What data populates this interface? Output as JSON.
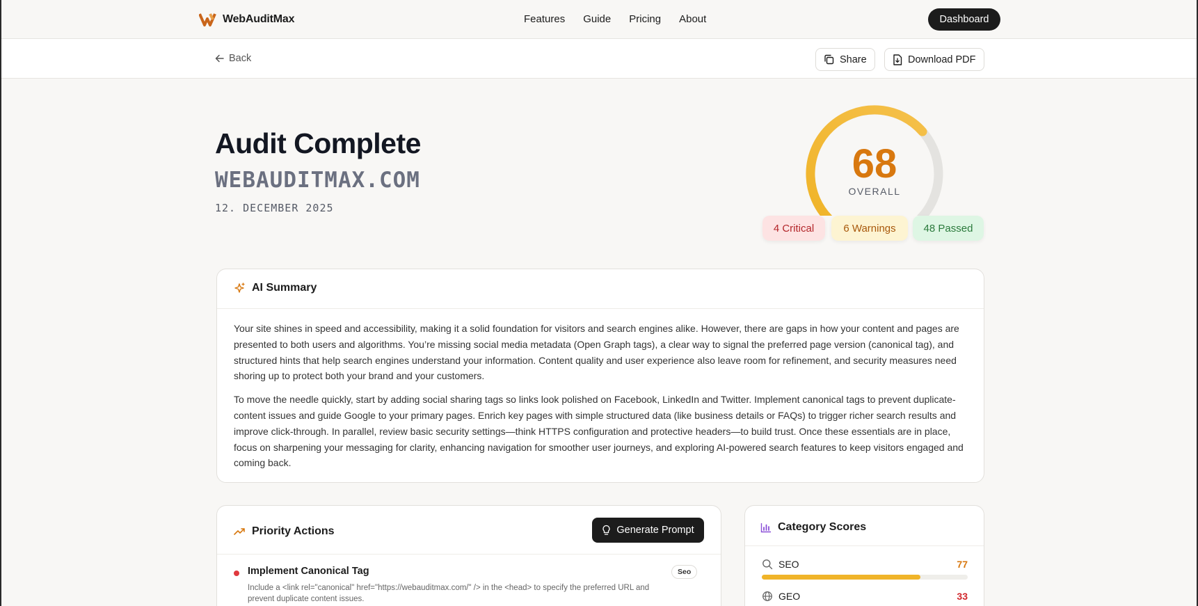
{
  "nav": {
    "brand": "WebAuditMax",
    "links": [
      "Features",
      "Guide",
      "Pricing",
      "About"
    ],
    "dashboard_label": "Dashboard"
  },
  "subbar": {
    "back_label": "Back",
    "share_label": "Share",
    "download_label": "Download PDF"
  },
  "hero": {
    "title": "Audit Complete",
    "domain": "WEBAUDITMAX.COM",
    "date": "12. DECEMBER 2025"
  },
  "score": {
    "value": "68",
    "fraction": 0.68,
    "label": "OVERALL",
    "color": "#d8780f",
    "critical": "4 Critical",
    "warnings": "6 Warnings",
    "passed": "48 Passed"
  },
  "summary": {
    "title": "AI Summary",
    "paragraphs": [
      "Your site shines in speed and accessibility, making it a solid foundation for visitors and search engines alike. However, there are gaps in how your content and pages are presented to both users and algorithms. You’re missing social media metadata (Open Graph tags), a clear way to signal the preferred page version (canonical tag), and structured hints that help search engines understand your information. Content quality and user experience also leave room for refinement, and security measures need shoring up to protect both your brand and your customers.",
      "To move the needle quickly, start by adding social sharing tags so links look polished on Facebook, LinkedIn and Twitter. Implement canonical tags to prevent duplicate-content issues and guide Google to your primary pages. Enrich key pages with simple structured data (like business details or FAQs) to trigger richer search results and improve click-through. In parallel, review basic security settings—think HTTPS configuration and protective headers—to build trust. Once these essentials are in place, focus on sharpening your messaging for clarity, enhancing navigation for smoother user journeys, and exploring AI-powered search features to keep visitors engaged and coming back."
    ]
  },
  "priority": {
    "title": "Priority Actions",
    "generate_label": "Generate Prompt",
    "items": [
      {
        "title": "Implement Canonical Tag",
        "tag": "Seo",
        "description": "Include a <link rel=\"canonical\" href=\"https://webauditmax.com/\" /> in the <head> to specify the preferred URL and prevent duplicate content issues."
      }
    ]
  },
  "categories": {
    "title": "Category Scores",
    "items": [
      {
        "name": "SEO",
        "score": "77",
        "fraction": 0.77,
        "color": "#d8780f",
        "bar_color": "#f0b429",
        "icon": "search-icon"
      },
      {
        "name": "GEO",
        "score": "33",
        "fraction": 0.33,
        "color": "#d1262b",
        "bar_color": "#e0393e",
        "icon": "globe-icon"
      }
    ]
  }
}
